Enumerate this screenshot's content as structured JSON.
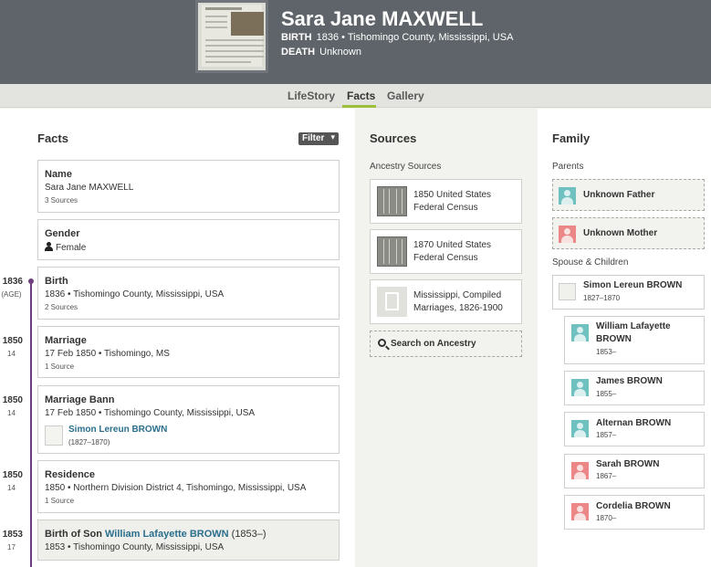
{
  "person": {
    "name": "Sara Jane MAXWELL",
    "birth_label": "BIRTH",
    "birth_value": "1836 • Tishomingo County, Mississippi, USA",
    "death_label": "DEATH",
    "death_value": "Unknown"
  },
  "tabs": [
    {
      "label": "LifeStory"
    },
    {
      "label": "Facts"
    },
    {
      "label": "Gallery"
    }
  ],
  "facts": {
    "title": "Facts",
    "filter_label": "Filter",
    "items": [
      {
        "title": "Name",
        "detail": "Sara Jane MAXWELL",
        "sources": "3 Sources"
      },
      {
        "title": "Gender",
        "detail": "Female"
      },
      {
        "year": "1836",
        "age": "(AGE)",
        "title": "Birth",
        "detail": "1836 • Tishomingo County, Mississippi, USA",
        "sources": "2 Sources"
      },
      {
        "year": "1850",
        "age": "14",
        "title": "Marriage",
        "detail": "17 Feb 1850 • Tishomingo, MS",
        "sources": "1 Source"
      },
      {
        "year": "1850",
        "age": "14",
        "title": "Marriage Bann",
        "detail": "17 Feb 1850 • Tishomingo County, Mississippi, USA",
        "spouse_name": "Simon Lereun BROWN",
        "spouse_dates": "(1827–1870)"
      },
      {
        "year": "1850",
        "age": "14",
        "title": "Residence",
        "detail": "1850 • Northern Division District 4, Tishomingo, Mississippi, USA",
        "sources": "1 Source"
      },
      {
        "year": "1853",
        "age": "17",
        "title_prefix": "Birth of Son",
        "title_link": "William Lafayette BROWN",
        "title_suffix": "(1853–)",
        "detail": "1853 • Tishomingo County, Mississippi, USA"
      }
    ]
  },
  "sources": {
    "title": "Sources",
    "subtitle": "Ancestry Sources",
    "items": [
      {
        "label": "1850 United States Federal Census"
      },
      {
        "label": "1870 United States Federal Census"
      },
      {
        "label": "Mississippi, Compiled Marriages, 1826-1900"
      }
    ],
    "search_label": "Search on Ancestry"
  },
  "family": {
    "title": "Family",
    "parents_label": "Parents",
    "parents": [
      {
        "name": "Unknown Father"
      },
      {
        "name": "Unknown Mother"
      }
    ],
    "spouse_label": "Spouse & Children",
    "spouse": {
      "name": "Simon Lereun BROWN",
      "dates": "1827–1870"
    },
    "children": [
      {
        "name": "William Lafayette BROWN",
        "dates": "1853–"
      },
      {
        "name": "James BROWN",
        "dates": "1855–"
      },
      {
        "name": "Alternan BROWN",
        "dates": "1857–"
      },
      {
        "name": "Sarah BROWN",
        "dates": "1867–"
      },
      {
        "name": "Cordelia BROWN",
        "dates": "1870–"
      }
    ]
  }
}
